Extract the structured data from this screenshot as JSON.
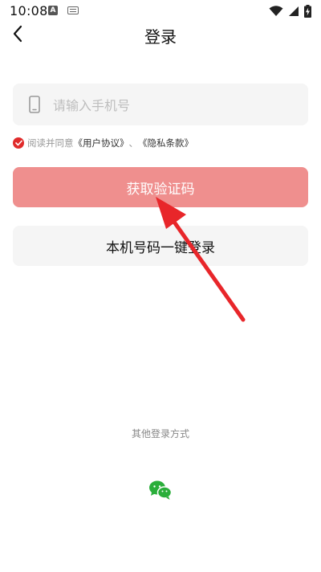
{
  "status_bar": {
    "time": "10:08",
    "left_icons": [
      "text-a-icon",
      "keyboard-icon"
    ],
    "right_icons": [
      "wifi-icon",
      "signal-icon",
      "battery-charging-icon"
    ]
  },
  "header": {
    "title": "登录",
    "back_icon": "back-arrow-icon"
  },
  "phone_input": {
    "placeholder": "请输入手机号",
    "value": "",
    "icon": "phone-icon"
  },
  "agreement": {
    "checked": true,
    "prefix": "阅读并同意",
    "user_agreement": "《用户协议》",
    "separator": "、",
    "privacy_policy": "《隐私条款》"
  },
  "buttons": {
    "get_code": "获取验证码",
    "one_key_login": "本机号码一键登录"
  },
  "other_login": {
    "title": "其他登录方式",
    "methods": [
      "wechat-icon"
    ]
  },
  "colors": {
    "primary_button": "#ef8f8e",
    "check_red": "#e02b2b",
    "arrow_red": "#e8262a",
    "input_bg": "#f5f5f5",
    "wechat_green": "#2aae3a"
  }
}
